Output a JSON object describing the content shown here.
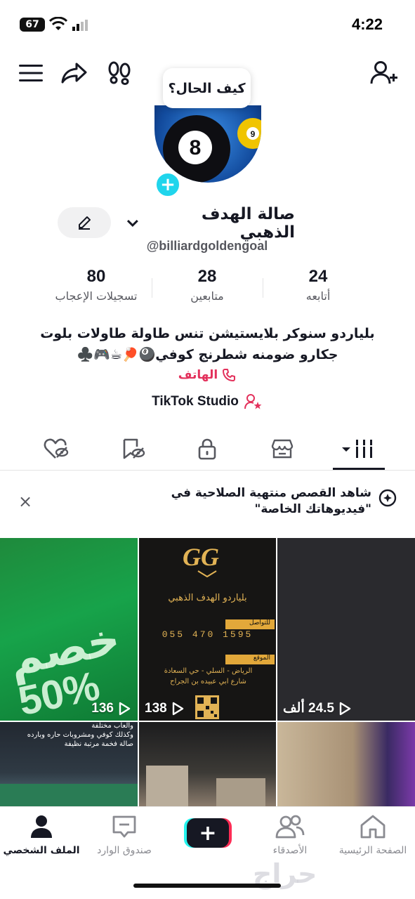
{
  "status_bar": {
    "battery": "67",
    "time": "4:22"
  },
  "bubble": {
    "text": "كيف الحال؟"
  },
  "profile": {
    "display_name": "صالة الهدف الذهبي",
    "username": "@billiardgoldengoal"
  },
  "stats": [
    {
      "number": "24",
      "label": "أتابعه"
    },
    {
      "number": "28",
      "label": "متابعين"
    },
    {
      "number": "80",
      "label": "تسجيلات الإعجاب"
    }
  ],
  "bio": {
    "line1": "بلياردو سنوكر بلايستيشن تنس طاولة طاولات بلوت",
    "line2": "جكارو ضومنه شطرنج كوفي🎱🏓☕🎮♣️",
    "phone_label": "الهاتف",
    "studio_label": "TikTok Studio"
  },
  "banner": {
    "text": "شاهد القصص منتهية الصلاحية في \"فيديوهاتك الخاصة\"",
    "close": "×"
  },
  "videos": [
    {
      "views": "24.5 ألف"
    },
    {
      "views": "138"
    },
    {
      "views": "136"
    }
  ],
  "tile_texts": {
    "discount": "خصم",
    "percent": "50%",
    "gg_logo": "GG",
    "card_title": "بلياردو الهدف الذهبي",
    "contact_label": "للتواصل",
    "phone": "055 470 1595",
    "location_label": "الموقع",
    "address_line1": "الرياض - السلي - حي السعادة",
    "address_line2": "شارع ابي عبيده بن الجراح",
    "promo_line1": "والعاب مختلفة",
    "promo_line2": "وكذلك كوفي ومشروبات حاره وبارده",
    "promo_line3": "صالة فخمة مرتبة نظيفة"
  },
  "bottom_nav": [
    {
      "label": "الصفحة الرئيسية",
      "icon": "home-icon"
    },
    {
      "label": "الأصدقاء",
      "icon": "friends-icon"
    },
    {
      "label": "صندوق الوارد",
      "icon": "inbox-icon"
    },
    {
      "label": "الملف الشخصي",
      "icon": "profile-icon"
    }
  ],
  "watermark": "حراج",
  "colors": {
    "accent": "#fe2c55",
    "cyan": "#25f4ee",
    "link": "#e3315c",
    "text": "#161823"
  }
}
